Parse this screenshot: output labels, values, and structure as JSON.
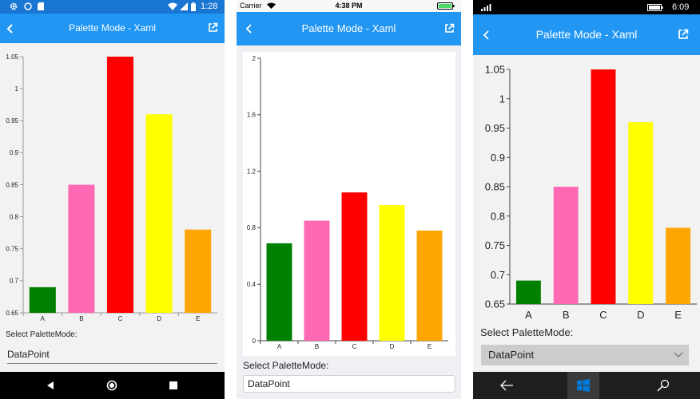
{
  "android": {
    "status": {
      "time": "1:28"
    },
    "header": {
      "title": "Palette Mode - Xaml"
    },
    "chart_data": {
      "type": "bar",
      "categories": [
        "A",
        "B",
        "C",
        "D",
        "E"
      ],
      "values": [
        0.69,
        0.85,
        1.05,
        0.96,
        0.78
      ],
      "colors": [
        "#008000",
        "#ff69b4",
        "#ff0000",
        "#ffff00",
        "#ffa500"
      ],
      "ylim": [
        0.65,
        1.05
      ],
      "yticks": [
        "0.65",
        "0.7",
        "0.75",
        "0.8",
        "0.85",
        "0.9",
        "0.95",
        "1",
        "1.05"
      ],
      "grid": false
    },
    "select_label": "Select PaletteMode:",
    "select_value": "DataPoint"
  },
  "ios": {
    "status": {
      "carrier": "Carrier",
      "time": "4:38 PM"
    },
    "header": {
      "title": "Palette Mode - Xaml"
    },
    "chart_data": {
      "type": "bar",
      "categories": [
        "A",
        "B",
        "C",
        "D",
        "E"
      ],
      "values": [
        0.69,
        0.85,
        1.05,
        0.96,
        0.78
      ],
      "colors": [
        "#008000",
        "#ff69b4",
        "#ff0000",
        "#ffff00",
        "#ffa500"
      ],
      "ylim": [
        0,
        2
      ],
      "yticks": [
        "0",
        "0.4",
        "0.8",
        "1.2",
        "1.6",
        "2"
      ],
      "grid": false
    },
    "select_label": "Select PaletteMode:",
    "select_value": "DataPoint"
  },
  "windows": {
    "status": {
      "time": "6:09"
    },
    "header": {
      "title": "Palette Mode - Xaml"
    },
    "chart_data": {
      "type": "bar",
      "categories": [
        "A",
        "B",
        "C",
        "D",
        "E"
      ],
      "values": [
        0.69,
        0.85,
        1.05,
        0.96,
        0.78
      ],
      "colors": [
        "#008000",
        "#ff69b4",
        "#ff0000",
        "#ffff00",
        "#ffa500"
      ],
      "ylim": [
        0.65,
        1.05
      ],
      "yticks": [
        "0.65",
        "0.7",
        "0.75",
        "0.8",
        "0.85",
        "0.9",
        "0.95",
        "1",
        "1.05"
      ],
      "grid": false
    },
    "select_label": "Select PaletteMode:",
    "select_value": "DataPoint"
  }
}
